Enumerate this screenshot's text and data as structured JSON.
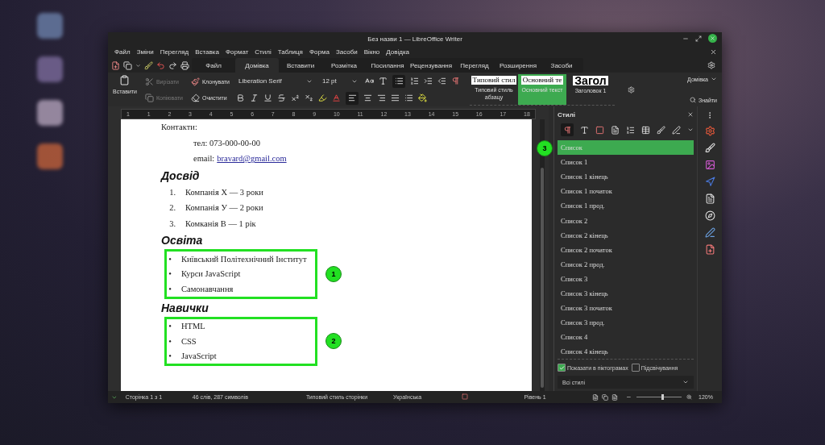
{
  "window": {
    "title": "Без назви 1 — LibreOffice Writer"
  },
  "menu": [
    "Файл",
    "Зміни",
    "Перегляд",
    "Вставка",
    "Формат",
    "Стилі",
    "Таблиця",
    "Форма",
    "Засоби",
    "Вікно",
    "Довідка"
  ],
  "tabs": [
    {
      "label": "Файл",
      "selected": false
    },
    {
      "label": "Домівка",
      "selected": true
    },
    {
      "label": "Вставити",
      "selected": false
    },
    {
      "label": "Розмітка",
      "selected": false
    },
    {
      "label": "Посилання",
      "selected": false
    },
    {
      "label": "Рецензування",
      "selected": false
    },
    {
      "label": "Перегляд",
      "selected": false
    },
    {
      "label": "Розширення",
      "selected": false
    },
    {
      "label": "Засоби",
      "selected": false
    }
  ],
  "toolbar": {
    "paste": "Вставити",
    "edit_buttons": [
      {
        "kind": "cut",
        "label": "Вирізати",
        "disabled": true
      },
      {
        "kind": "copy",
        "label": "Копіювати",
        "disabled": true
      },
      {
        "kind": "clone",
        "label": "Клонувати",
        "disabled": false
      },
      {
        "kind": "clear",
        "label": "Очистити",
        "disabled": false
      }
    ],
    "font": "Liberation Serif",
    "size": "12 pt",
    "style_presets": [
      {
        "preview": "Типовий стил",
        "label": "Типовий стиль абзацу",
        "kind": "serif",
        "selected": false
      },
      {
        "preview": "Основний те",
        "label": "Основний текст",
        "kind": "serif",
        "selected": true
      },
      {
        "preview": "Загол",
        "label": "Заголовок 1",
        "kind": "heading",
        "selected": false
      }
    ],
    "context": "Домівка",
    "find": "Знайти"
  },
  "ruler": [
    "1",
    "1",
    "2",
    "3",
    "4",
    "5",
    "6",
    "7",
    "8",
    "9",
    "10",
    "11",
    "12",
    "13",
    "14",
    "15",
    "16",
    "17",
    "18"
  ],
  "document": [
    {
      "kind": "text",
      "text": "Контакти:"
    },
    {
      "kind": "indent",
      "text": "тел: 073-000-00-00"
    },
    {
      "kind": "link",
      "label": "email:",
      "link": "bravard@gmail.com"
    },
    {
      "kind": "heading",
      "text": "Досвід"
    },
    {
      "kind": "numbered",
      "items": [
        {
          "marker": "1.",
          "text": "Компанія Х — 3 роки"
        },
        {
          "marker": "2.",
          "text": "Компанія У — 2 роки"
        },
        {
          "marker": "3.",
          "text": "Комканія В — 1 рік"
        }
      ]
    },
    {
      "kind": "heading",
      "text": "Освіта"
    },
    {
      "kind": "bullets",
      "callout": "1",
      "items": [
        {
          "marker": "•",
          "text": "Київський Політехнічний Інститут"
        },
        {
          "marker": "•",
          "text": "Курси JavaScript"
        },
        {
          "marker": "•",
          "text": "Самонавчання"
        }
      ]
    },
    {
      "kind": "heading",
      "text": "Навички"
    },
    {
      "kind": "bullets",
      "callout": "2",
      "items": [
        {
          "marker": "•",
          "text": "HTML"
        },
        {
          "marker": "•",
          "text": "CSS"
        },
        {
          "marker": "•",
          "text": "JavaScript"
        }
      ]
    }
  ],
  "styles_panel": {
    "title": "Стилі",
    "callout": "3",
    "items": [
      {
        "label": "Список",
        "selected": true
      },
      {
        "label": "Список 1",
        "selected": false
      },
      {
        "label": "Список 1 кінець",
        "selected": false
      },
      {
        "label": "Список 1 початок",
        "selected": false
      },
      {
        "label": "Список 1 прод.",
        "selected": false
      },
      {
        "label": "Список 2",
        "selected": false
      },
      {
        "label": "Список 2 кінець",
        "selected": false
      },
      {
        "label": "Список 2 початок",
        "selected": false
      },
      {
        "label": "Список 2 прод.",
        "selected": false
      },
      {
        "label": "Список 3",
        "selected": false
      },
      {
        "label": "Список 3 кінець",
        "selected": false
      },
      {
        "label": "Список 3 початок",
        "selected": false
      },
      {
        "label": "Список 3 прод.",
        "selected": false
      },
      {
        "label": "Список 4",
        "selected": false
      },
      {
        "label": "Список 4 кінець",
        "selected": false
      }
    ],
    "options": [
      {
        "label": "Показати в піктограмах",
        "checked": true
      },
      {
        "label": "Підсвічування",
        "checked": false
      }
    ],
    "filter": "Всі стилі"
  },
  "status_bar": {
    "page": "Сторінка 1 з 1",
    "words": "46 слів, 287 символів",
    "page_style": "Типовий стиль сторінки",
    "language": "Українська",
    "outline": "Рівень 1",
    "zoom": "120%",
    "zoom_slider": {
      "level": 0.55
    }
  }
}
